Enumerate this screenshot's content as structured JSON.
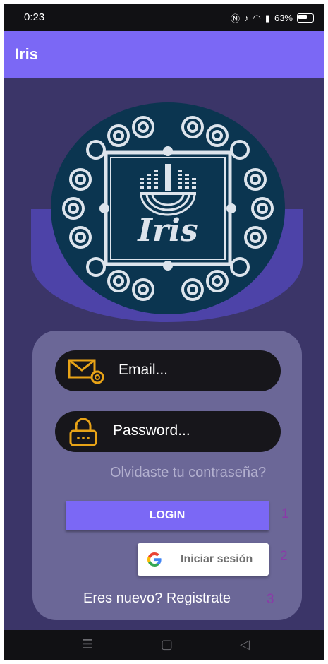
{
  "status_bar": {
    "time": "0:23",
    "battery": "63%",
    "icons": [
      "nfc-icon",
      "mute-icon",
      "wifi-icon",
      "signal-icon",
      "battery-icon"
    ]
  },
  "app_bar": {
    "title": "Iris"
  },
  "logo": {
    "text": "Iris"
  },
  "login_form": {
    "email_placeholder": "Email...",
    "password_placeholder": "Password...",
    "forgot_password": "Olvidaste tu contraseña?",
    "login_button": "LOGIN",
    "google_button": "Iniciar sesión",
    "register_link": "Eres nuevo? Registrate"
  },
  "markers": [
    "1",
    "2",
    "3"
  ],
  "colors": {
    "primary": "#7b68f5",
    "background": "#3b3568",
    "card": "#6b6797",
    "field": "#17161b",
    "icon_accent": "#e8a317",
    "logo_circle": "#0b3550"
  }
}
